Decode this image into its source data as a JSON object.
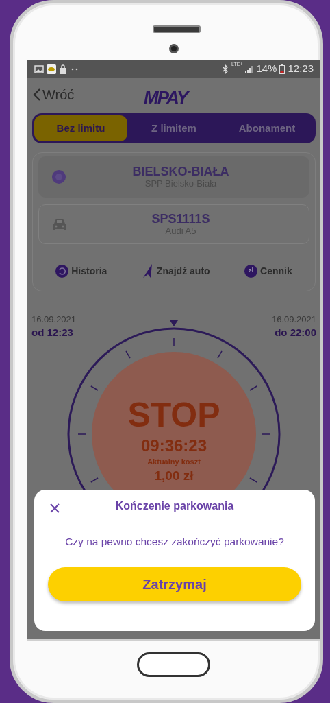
{
  "status_bar": {
    "network": "LTE+",
    "battery": "14%",
    "time": "12:23"
  },
  "header": {
    "back": "Wróć",
    "logo": "MPAY"
  },
  "tabs": [
    {
      "label": "Bez limitu",
      "selected": true
    },
    {
      "label": "Z limitem",
      "selected": false
    },
    {
      "label": "Abonament",
      "selected": false
    }
  ],
  "zone": {
    "title": "BIELSKO-BIAŁA",
    "subtitle": "SPP Bielsko-Biała"
  },
  "vehicle": {
    "plate": "SPS1111S",
    "model": "Audi A5"
  },
  "actions": [
    {
      "kind": "history",
      "label": "Historia"
    },
    {
      "kind": "navigate",
      "label": "Znajdź auto"
    },
    {
      "kind": "price",
      "label": "Cennik",
      "icon_text": "zł"
    }
  ],
  "timer": {
    "start_date": "16.09.2021",
    "start_time": "od 12:23",
    "end_date": "16.09.2021",
    "end_time": "do 22:00",
    "action": "STOP",
    "elapsed": "09:36:23",
    "cost_label": "Aktualny koszt",
    "cost": "1,00 zł"
  },
  "dialog": {
    "title": "Kończenie parkowania",
    "message": "Czy na pewno chcesz zakończyć parkowanie?",
    "button": "Zatrzymaj"
  }
}
